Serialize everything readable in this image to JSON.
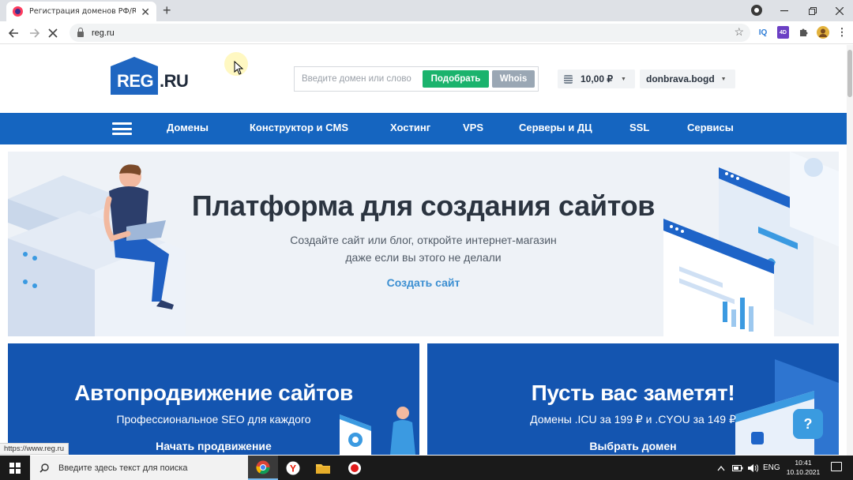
{
  "browser": {
    "tab_title": "Регистрация доменов РФ/RU у",
    "tab_close": "✕",
    "new_tab": "+",
    "url": "reg.ru",
    "status_url": "https://www.reg.ru",
    "extensions": [
      "IQ",
      "4D"
    ]
  },
  "header": {
    "logo_main": "REG",
    "logo_suffix": ".RU",
    "search_placeholder": "Введите домен или слово",
    "find_button": "Подобрать",
    "whois_button": "Whois",
    "balance": "10,00 ₽",
    "account": "donbrava.bogd"
  },
  "nav": {
    "items": [
      "Домены",
      "Конструктор и CMS",
      "Хостинг",
      "VPS",
      "Серверы и ДЦ",
      "SSL",
      "Сервисы"
    ]
  },
  "hero": {
    "title": "Платформа для создания сайтов",
    "subtitle_line1": "Создайте сайт или блог, откройте интернет-магазин",
    "subtitle_line2": "даже если вы этого не делали",
    "link": "Создать сайт"
  },
  "cards": [
    {
      "title": "Автопродвижение сайтов",
      "subtitle": "Профессиональное SEO для каждого",
      "link": "Начать продвижение"
    },
    {
      "title": "Пусть вас заметят!",
      "subtitle": "Домены .ICU за 199 ₽ и .CYOU за 149 ₽",
      "link": "Выбрать домен"
    }
  ],
  "help_button": "?",
  "taskbar": {
    "search_placeholder": "Введите здесь текст для поиска",
    "language": "ENG",
    "time": "10:41",
    "date": "10.10.2021"
  },
  "colors": {
    "nav_blue": "#1565c0",
    "card_blue": "#1455b0",
    "find_green": "#1bb36d",
    "whois_gray": "#9aa7b4",
    "link_blue": "#3a8ed1"
  }
}
